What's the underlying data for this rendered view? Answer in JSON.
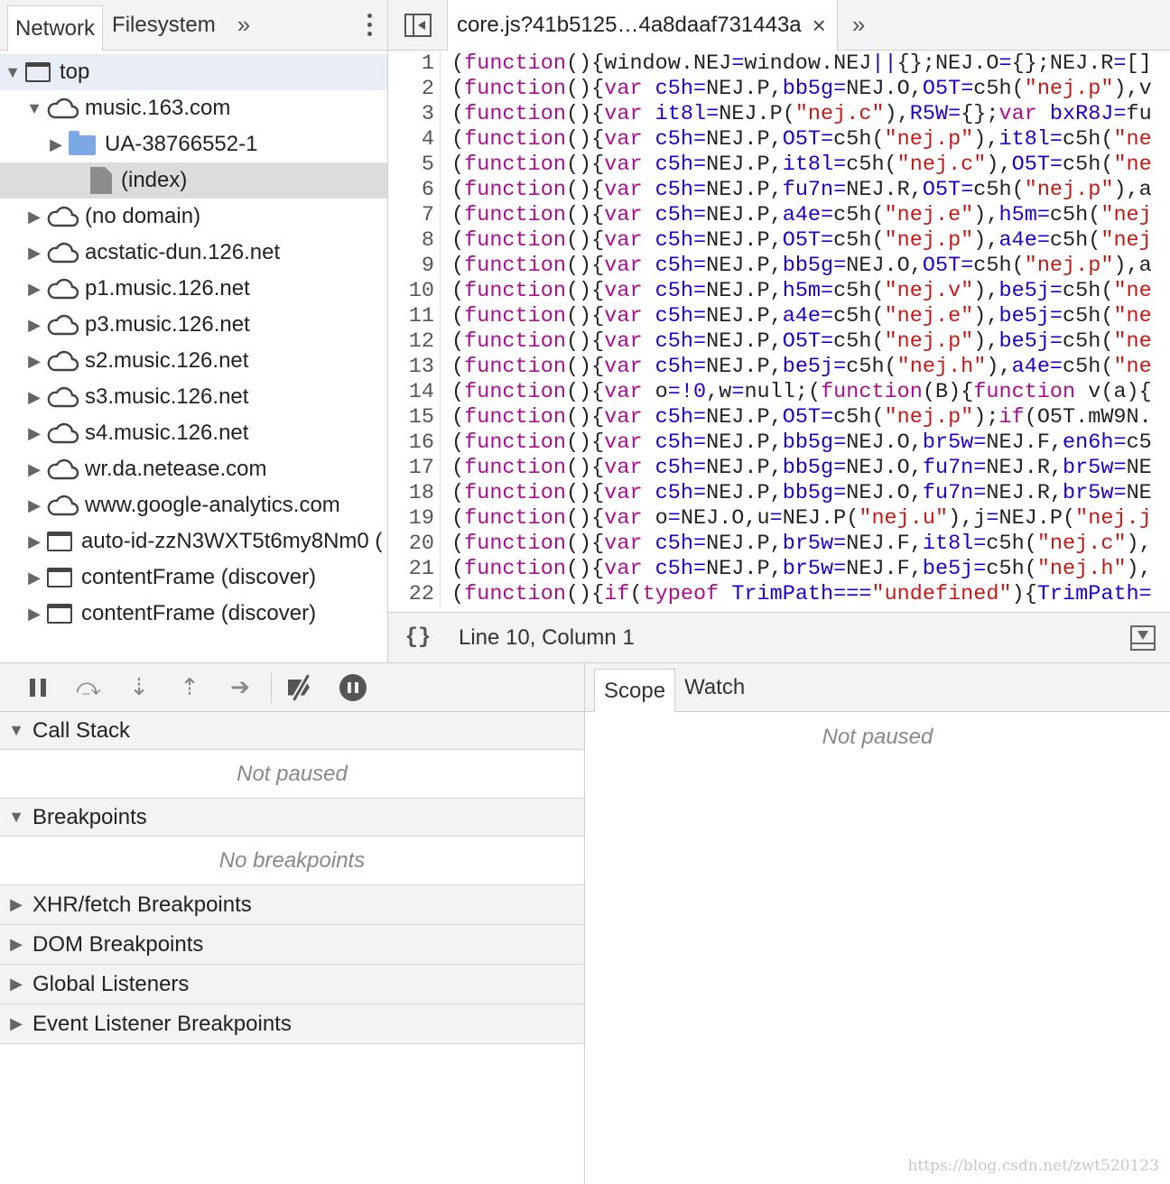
{
  "navigator": {
    "tabs": [
      "Network",
      "Filesystem"
    ],
    "more": "»",
    "tree": [
      {
        "label": "top",
        "icon": "frame-icon",
        "depth": 0,
        "expand": "▼",
        "state": "sel-top"
      },
      {
        "label": "music.163.com",
        "icon": "cloud-icon",
        "depth": 1,
        "expand": "▼"
      },
      {
        "label": "UA-38766552-1",
        "icon": "folder-icon",
        "depth": 2,
        "expand": "▶"
      },
      {
        "label": "(index)",
        "icon": "file-icon",
        "depth": 3,
        "expand": "",
        "state": "sel"
      },
      {
        "label": "(no domain)",
        "icon": "cloud-icon",
        "depth": 1,
        "expand": "▶"
      },
      {
        "label": "acstatic-dun.126.net",
        "icon": "cloud-icon",
        "depth": 1,
        "expand": "▶"
      },
      {
        "label": "p1.music.126.net",
        "icon": "cloud-icon",
        "depth": 1,
        "expand": "▶"
      },
      {
        "label": "p3.music.126.net",
        "icon": "cloud-icon",
        "depth": 1,
        "expand": "▶"
      },
      {
        "label": "s2.music.126.net",
        "icon": "cloud-icon",
        "depth": 1,
        "expand": "▶"
      },
      {
        "label": "s3.music.126.net",
        "icon": "cloud-icon",
        "depth": 1,
        "expand": "▶"
      },
      {
        "label": "s4.music.126.net",
        "icon": "cloud-icon",
        "depth": 1,
        "expand": "▶"
      },
      {
        "label": "wr.da.netease.com",
        "icon": "cloud-icon",
        "depth": 1,
        "expand": "▶"
      },
      {
        "label": "www.google-analytics.com",
        "icon": "cloud-icon",
        "depth": 1,
        "expand": "▶"
      },
      {
        "label": "auto-id-zzN3WXT5t6my8Nm0 (",
        "icon": "frame-icon",
        "depth": 1,
        "expand": "▶"
      },
      {
        "label": "contentFrame (discover)",
        "icon": "frame-icon",
        "depth": 1,
        "expand": "▶"
      },
      {
        "label": "contentFrame (discover)",
        "icon": "frame-icon",
        "depth": 1,
        "expand": "▶"
      }
    ]
  },
  "editor": {
    "file_tab": "core.js?41b5125…4a8daaf731443a",
    "close": "×",
    "more": "»",
    "lines": [
      "(function(){window.NEJ=window.NEJ||{};NEJ.O={};NEJ.R=[]",
      "(function(){var c5h=NEJ.P,bb5g=NEJ.O,O5T=c5h(\"nej.p\"),v",
      "(function(){var it8l=NEJ.P(\"nej.c\"),R5W={};var bxR8J=fu",
      "(function(){var c5h=NEJ.P,O5T=c5h(\"nej.p\"),it8l=c5h(\"ne",
      "(function(){var c5h=NEJ.P,it8l=c5h(\"nej.c\"),O5T=c5h(\"ne",
      "(function(){var c5h=NEJ.P,fu7n=NEJ.R,O5T=c5h(\"nej.p\"),a",
      "(function(){var c5h=NEJ.P,a4e=c5h(\"nej.e\"),h5m=c5h(\"nej",
      "(function(){var c5h=NEJ.P,O5T=c5h(\"nej.p\"),a4e=c5h(\"nej",
      "(function(){var c5h=NEJ.P,bb5g=NEJ.O,O5T=c5h(\"nej.p\"),a",
      "(function(){var c5h=NEJ.P,h5m=c5h(\"nej.v\"),be5j=c5h(\"ne",
      "(function(){var c5h=NEJ.P,a4e=c5h(\"nej.e\"),be5j=c5h(\"ne",
      "(function(){var c5h=NEJ.P,O5T=c5h(\"nej.p\"),be5j=c5h(\"ne",
      "(function(){var c5h=NEJ.P,be5j=c5h(\"nej.h\"),a4e=c5h(\"ne",
      "(function(){var o=!0,w=null;(function(B){function v(a){",
      "(function(){var c5h=NEJ.P,O5T=c5h(\"nej.p\");if(O5T.mW9N.",
      "(function(){var c5h=NEJ.P,bb5g=NEJ.O,br5w=NEJ.F,en6h=c5",
      "(function(){var c5h=NEJ.P,bb5g=NEJ.O,fu7n=NEJ.R,br5w=NE",
      "(function(){var c5h=NEJ.P,bb5g=NEJ.O,fu7n=NEJ.R,br5w=NE",
      "(function(){var o=NEJ.O,u=NEJ.P(\"nej.u\"),j=NEJ.P(\"nej.j",
      "(function(){var c5h=NEJ.P,br5w=NEJ.F,it8l=c5h(\"nej.c\"),",
      "(function(){var c5h=NEJ.P,br5w=NEJ.F,be5j=c5h(\"nej.h\"),",
      "(function(){if(typeof TrimPath===\"undefined\"){TrimPath="
    ],
    "pretty_print": "{}",
    "cursor_position": "Line 10, Column 1"
  },
  "debugger": {
    "sections": [
      {
        "title": "Call Stack",
        "expanded": true,
        "empty_text": "Not paused"
      },
      {
        "title": "Breakpoints",
        "expanded": true,
        "empty_text": "No breakpoints"
      },
      {
        "title": "XHR/fetch Breakpoints",
        "expanded": false
      },
      {
        "title": "DOM Breakpoints",
        "expanded": false
      },
      {
        "title": "Global Listeners",
        "expanded": false
      },
      {
        "title": "Event Listener Breakpoints",
        "expanded": false
      }
    ]
  },
  "scope": {
    "tabs": [
      "Scope",
      "Watch"
    ],
    "empty_text": "Not paused"
  },
  "watermark": "https://blog.csdn.net/zwt520123"
}
